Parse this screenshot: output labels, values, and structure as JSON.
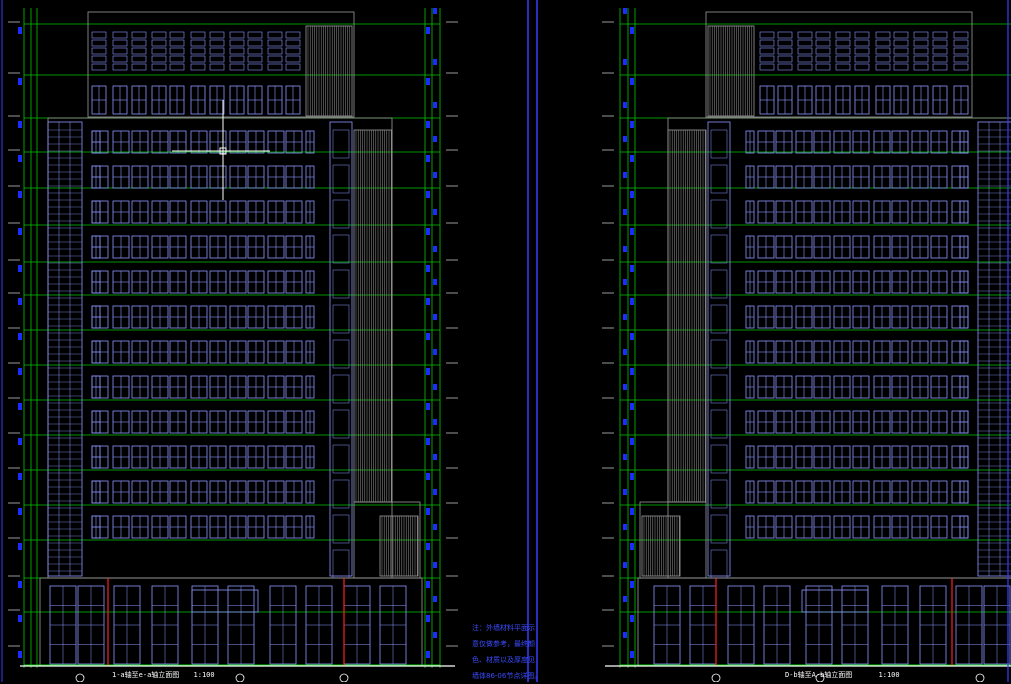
{
  "drawings": [
    {
      "id": "left",
      "title": "1-a轴至e-a轴立面图",
      "scale": "1:100",
      "tower_floors": 12
    },
    {
      "id": "right",
      "title": "D-b轴至A-b轴立面图",
      "scale": "1:100",
      "tower_floors": 12
    }
  ],
  "notes": {
    "lines": [
      "注：外墙材料平面示",
      "意仅做参考，最终颜",
      "色、材质以及厚度见",
      "墙体86-06节点详图。"
    ]
  },
  "colors": {
    "background": "#000000",
    "grid_green": "#00c800",
    "window_blue": "#8c96ff",
    "marker_blue": "#1a2cff",
    "building_gray": "#9a9a9a",
    "red_line": "#ff2020",
    "white": "#ffffff",
    "divider": "#3a3aff"
  }
}
